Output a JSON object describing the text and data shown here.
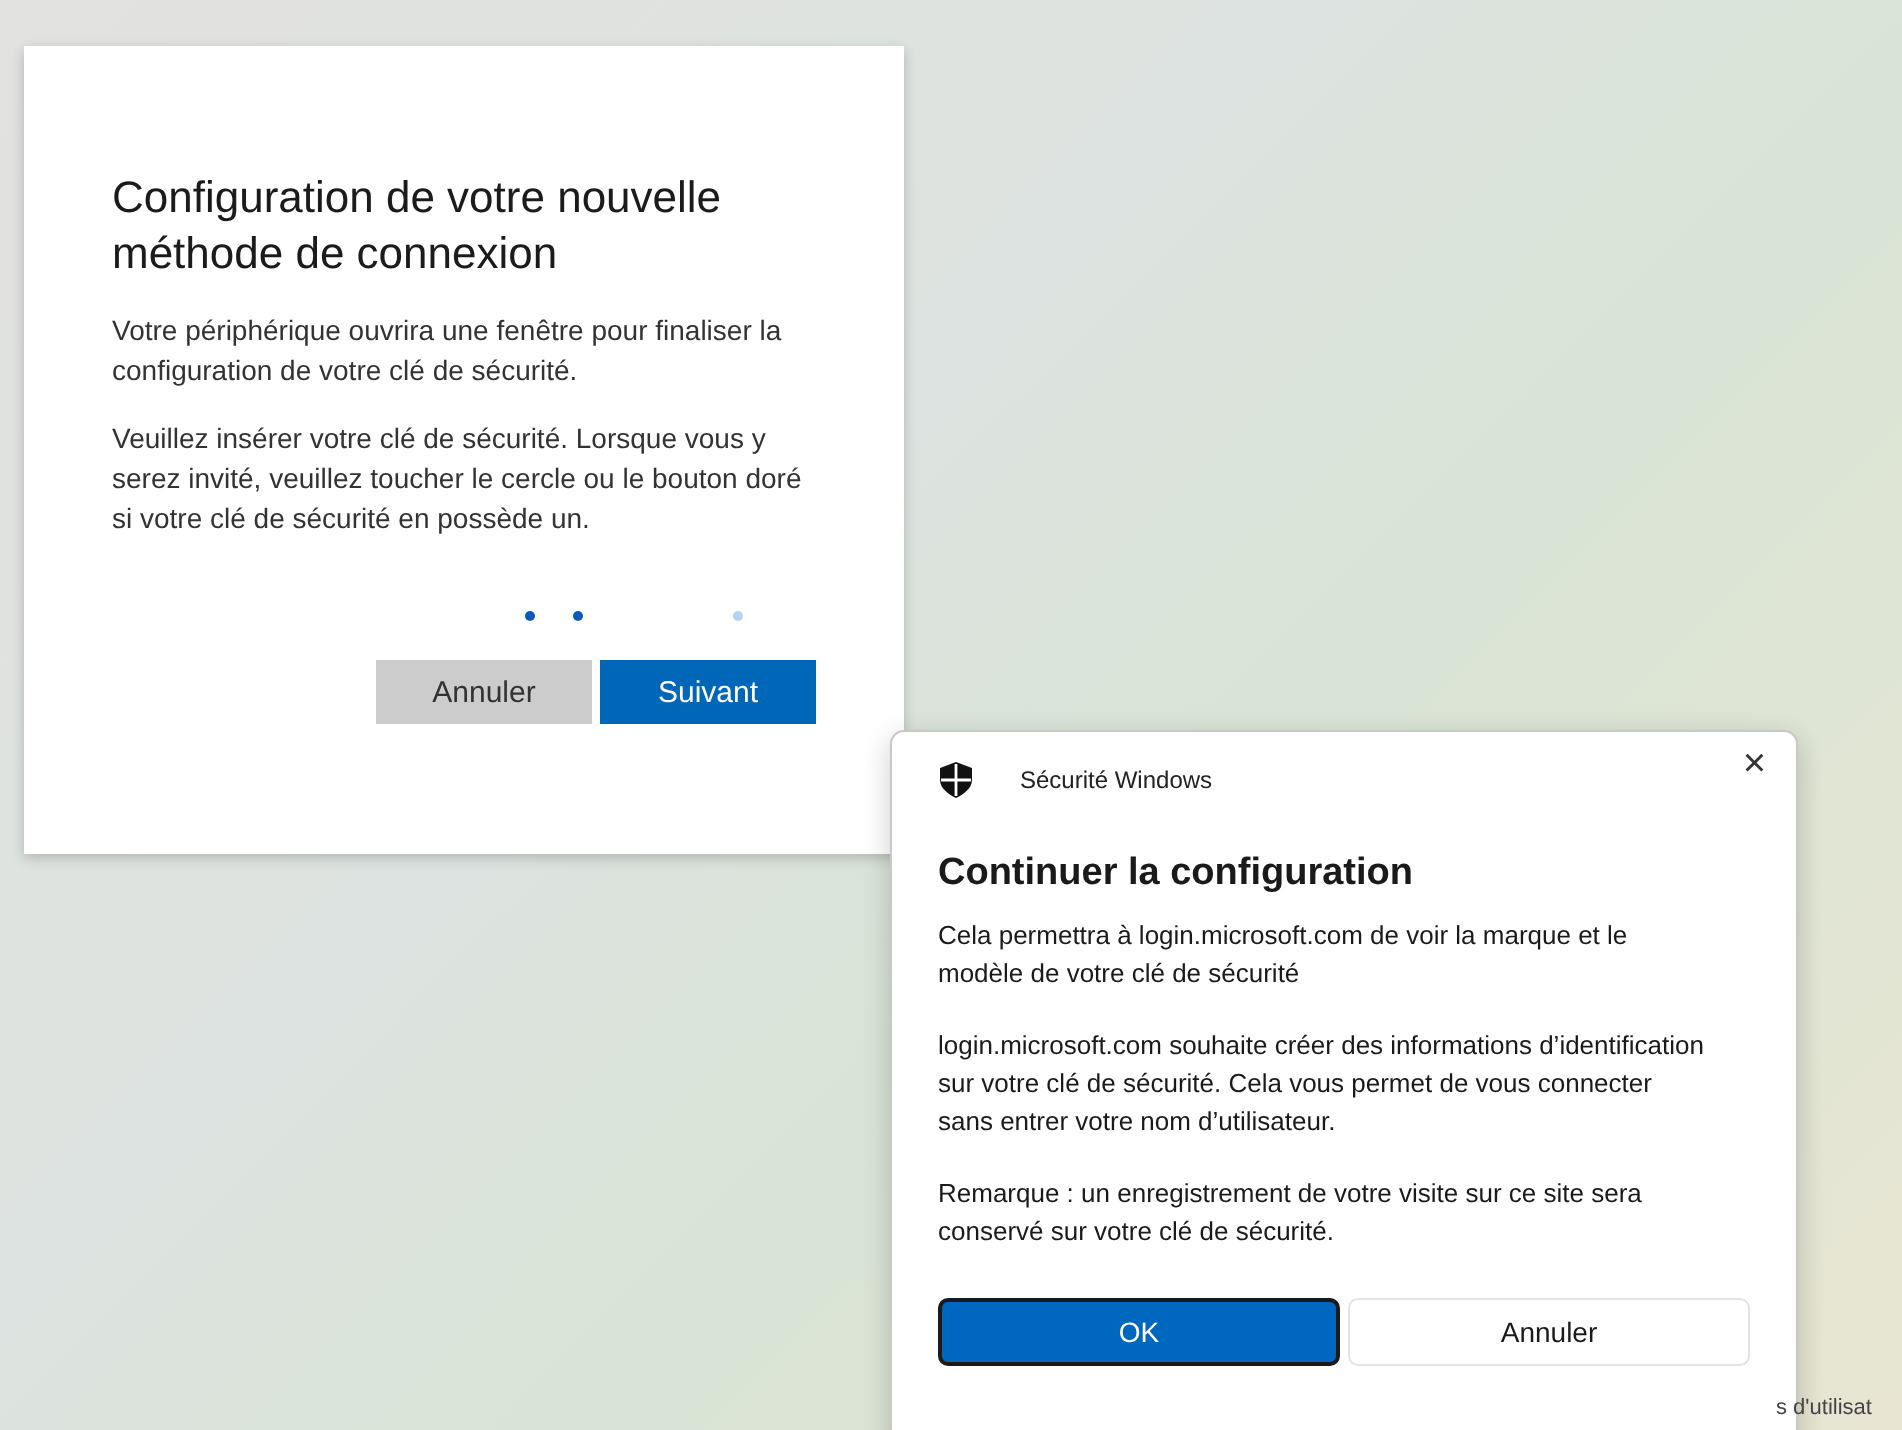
{
  "setup_card": {
    "title": "Configuration de votre nouvelle méthode de connexion",
    "paragraphs": [
      "Votre périphérique ouvrira une fenêtre pour finaliser la configuration de votre clé de sécurité.",
      "Veuillez insérer votre clé de sécurité. Lorsque vous y serez invité, veuillez toucher le cercle ou le bouton doré si votre clé de sécurité en possède un."
    ],
    "buttons": [
      {
        "label": "Annuler",
        "kind": "secondary"
      },
      {
        "label": "Suivant",
        "kind": "primary"
      }
    ]
  },
  "security_dialog": {
    "app_title": "Sécurité Windows",
    "close": "×",
    "heading": "Continuer la configuration",
    "paragraphs": [
      "Cela permettra à login.microsoft.com de voir la marque et le modèle de votre clé de sécurité",
      "login.microsoft.com souhaite créer des informations d’identification sur votre clé de sécurité. Cela vous permet de vous connecter sans entrer votre nom d’utilisateur.",
      "Remarque : un enregistrement de votre visite sur ce site sera conservé sur votre clé de sécurité."
    ],
    "buttons": [
      {
        "label": "OK",
        "kind": "primary"
      },
      {
        "label": "Annuler",
        "kind": "secondary"
      }
    ]
  },
  "background_text": "s d'utilisat"
}
